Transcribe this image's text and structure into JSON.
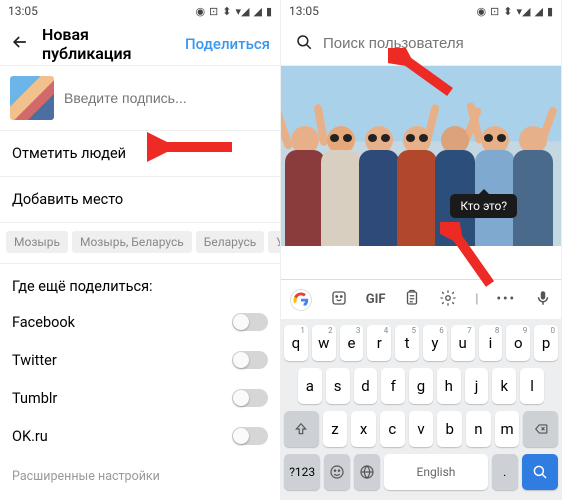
{
  "statusbar": {
    "time": "13:05"
  },
  "left": {
    "title": "Новая публикация",
    "share": "Поделиться",
    "caption_placeholder": "Введите подпись...",
    "tag_people": "Отметить людей",
    "add_location": "Добавить место",
    "location_chips": [
      "Мозырь",
      "Мозырь, Беларусь",
      "Беларусь",
      "Украина"
    ],
    "share_also": "Где ещё поделиться:",
    "share_targets": [
      "Facebook",
      "Twitter",
      "Tumblr",
      "OK.ru"
    ],
    "advanced": "Расширенные настройки"
  },
  "right": {
    "search_placeholder": "Поиск пользователя",
    "tag_tooltip": "Кто это?",
    "suggestion_gif": "GIF",
    "keyboard": {
      "row1": [
        [
          "q",
          "1"
        ],
        [
          "w",
          "2"
        ],
        [
          "e",
          "3"
        ],
        [
          "r",
          "4"
        ],
        [
          "t",
          "5"
        ],
        [
          "y",
          "6"
        ],
        [
          "u",
          "7"
        ],
        [
          "i",
          "8"
        ],
        [
          "o",
          "9"
        ],
        [
          "p",
          "0"
        ]
      ],
      "row2": [
        "a",
        "s",
        "d",
        "f",
        "g",
        "h",
        "j",
        "k",
        "l"
      ],
      "row3": [
        "z",
        "x",
        "c",
        "v",
        "b",
        "n",
        "m"
      ],
      "numkey": "?123",
      "space": "English"
    }
  }
}
